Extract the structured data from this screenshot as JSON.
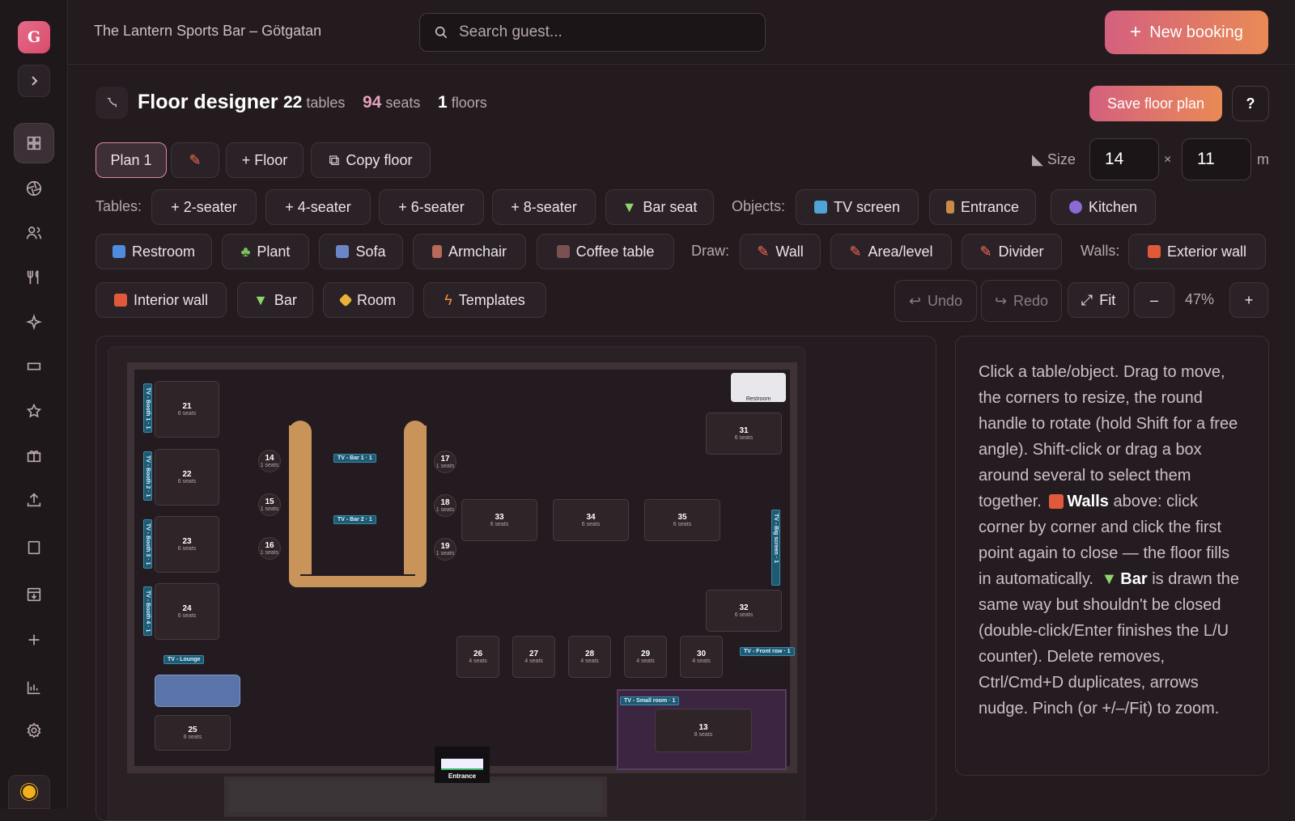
{
  "sidebar": {
    "avatar_letter": "G",
    "items": [
      "grid-icon",
      "aperture-icon",
      "users-icon",
      "utensils-icon",
      "sparkle-icon",
      "ticket-icon",
      "star-icon",
      "gift-icon",
      "upload-icon",
      "book-icon",
      "inbox-icon",
      "plus-icon",
      "bar-chart-icon",
      "settings-icon"
    ]
  },
  "header": {
    "venue": "The Lantern Sports Bar – Götgatan",
    "search_placeholder": "Search guest...",
    "new_booking": "New booking"
  },
  "page": {
    "title": "Floor designer",
    "tables_count": "22",
    "tables_label": "tables",
    "seats_count": "94",
    "seats_label": "seats",
    "floors_count": "1",
    "floors_label": "floors",
    "save": "Save floor plan",
    "help": "?"
  },
  "toolbar": {
    "plan": "Plan 1",
    "add_floor": "+ Floor",
    "copy_floor": "Copy floor",
    "size_label": "Size",
    "width": "14",
    "times": "×",
    "height": "11",
    "unit": "m",
    "tables_label": "Tables:",
    "seater2": "+ 2-seater",
    "seater4": "+ 4-seater",
    "seater6": "+ 6-seater",
    "seater8": "+ 8-seater",
    "bar_seat": "Bar seat",
    "objects_label": "Objects:",
    "tv_screen": "TV screen",
    "entrance": "Entrance",
    "kitchen": "Kitchen",
    "restroom": "Restroom",
    "plant": "Plant",
    "sofa": "Sofa",
    "armchair": "Armchair",
    "coffee_table": "Coffee table",
    "draw_label": "Draw:",
    "wall": "Wall",
    "area": "Area/level",
    "divider": "Divider",
    "walls_label": "Walls:",
    "exterior_wall": "Exterior wall",
    "interior_wall": "Interior wall",
    "bar": "Bar",
    "room": "Room",
    "templates": "Templates",
    "undo": "Undo",
    "redo": "Redo",
    "fit": "Fit",
    "zoom_out": "–",
    "zoom": "47%",
    "zoom_in": "+"
  },
  "floor": {
    "tables": [
      {
        "id": "21",
        "seats": "6 seats"
      },
      {
        "id": "22",
        "seats": "6 seats"
      },
      {
        "id": "23",
        "seats": "6 seats"
      },
      {
        "id": "24",
        "seats": "6 seats"
      },
      {
        "id": "25",
        "seats": "6 seats"
      },
      {
        "id": "14",
        "seats": "1 seats"
      },
      {
        "id": "15",
        "seats": "1 seats"
      },
      {
        "id": "16",
        "seats": "1 seats"
      },
      {
        "id": "17",
        "seats": "1 seats"
      },
      {
        "id": "18",
        "seats": "1 seats"
      },
      {
        "id": "19",
        "seats": "1 seats"
      },
      {
        "id": "33",
        "seats": "6 seats"
      },
      {
        "id": "34",
        "seats": "6 seats"
      },
      {
        "id": "35",
        "seats": "6 seats"
      },
      {
        "id": "31",
        "seats": "6 seats"
      },
      {
        "id": "32",
        "seats": "6 seats"
      },
      {
        "id": "26",
        "seats": "4 seats"
      },
      {
        "id": "27",
        "seats": "4 seats"
      },
      {
        "id": "28",
        "seats": "4 seats"
      },
      {
        "id": "29",
        "seats": "4 seats"
      },
      {
        "id": "30",
        "seats": "4 seats"
      },
      {
        "id": "13",
        "seats": "8 seats"
      }
    ],
    "tvs": {
      "booth1": "TV - Booth 1 · 1",
      "booth2": "TV - Booth 2 · 1",
      "booth3": "TV - Booth 3 · 1",
      "booth4": "TV - Booth 4 · 1",
      "lounge": "TV - Lounge",
      "bar1": "TV - Bar 1 · 1",
      "bar2": "TV - Bar 2 · 1",
      "big": "TV - Big screen · 1",
      "front": "TV - Front row · 1",
      "small": "TV - Small room · 1"
    },
    "restroom": "Restroom",
    "entrance": "Entrance"
  },
  "help_text": {
    "p1": "Click a table/object. Drag to move, the corners to resize, the round handle to rotate (hold Shift for a free angle). Shift-click or drag a box around several to select them together.",
    "walls": "Walls",
    "p2": "above: click corner by corner and click the first point again to close — the floor fills in automatically.",
    "bar": "Bar",
    "p3": "is drawn the same way but shouldn't be closed (double-click/Enter finishes the L/U counter). Delete removes, Ctrl/Cmd+D duplicates, arrows nudge. Pinch (or +/–/Fit) to zoom."
  }
}
